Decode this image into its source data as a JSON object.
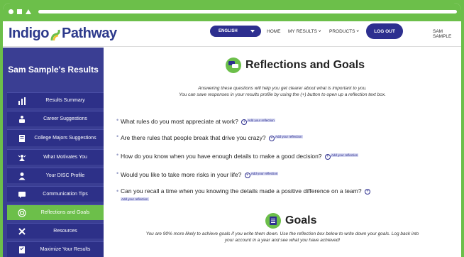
{
  "header": {
    "logo_part1": "Indigo",
    "logo_part2": "Pathway",
    "language": "ENGLISH",
    "nav_home": "HOME",
    "nav_results": "MY RESULTS",
    "nav_products": "PRODUCTS",
    "logout": "LOG OUT",
    "user": "SAM SAMPLE"
  },
  "sidebar": {
    "title": "Sam Sample's Results",
    "items": [
      {
        "label": "Results Summary",
        "icon": "bar-chart-icon"
      },
      {
        "label": "Career Suggestions",
        "icon": "briefcase-person-icon"
      },
      {
        "label": "College Majors Suggestions",
        "icon": "document-icon"
      },
      {
        "label": "What Motivates You",
        "icon": "motivation-icon"
      },
      {
        "label": "Your DISC Profile",
        "icon": "person-icon"
      },
      {
        "label": "Communication Tips",
        "icon": "chat-icon"
      },
      {
        "label": "Reflections and Goals",
        "icon": "target-icon"
      },
      {
        "label": "Resources",
        "icon": "tools-icon"
      },
      {
        "label": "Maximize Your Results",
        "icon": "checklist-icon"
      }
    ]
  },
  "main": {
    "reflections_title": "Reflections and Goals",
    "intro_line1": "Answering these questions will help you get clearer about what is important to you.",
    "intro_line2": "You can save responses in your results profile by using the (+) button to open up a reflection text box.",
    "add_label": "Add your reflection",
    "questions": [
      "What rules do you most appreciate at work?",
      "Are there rules that people break that drive you crazy?",
      "How do you know when you have enough details to make a good decision?",
      "Would you like to take more risks in your life?",
      "Can you recall a time when you knowing the details made a positive difference on a team?"
    ],
    "goals_title": "Goals",
    "goals_line1": "You are 90% more likely to achieve goals if you write them down. Use the reflection box below to write down your goals. Log back into",
    "goals_line2": "your account in a year and see what you have achieved!"
  },
  "colors": {
    "brand_indigo": "#2d2f8f",
    "brand_green": "#6cbf4a",
    "sidebar": "#3a3e93"
  }
}
